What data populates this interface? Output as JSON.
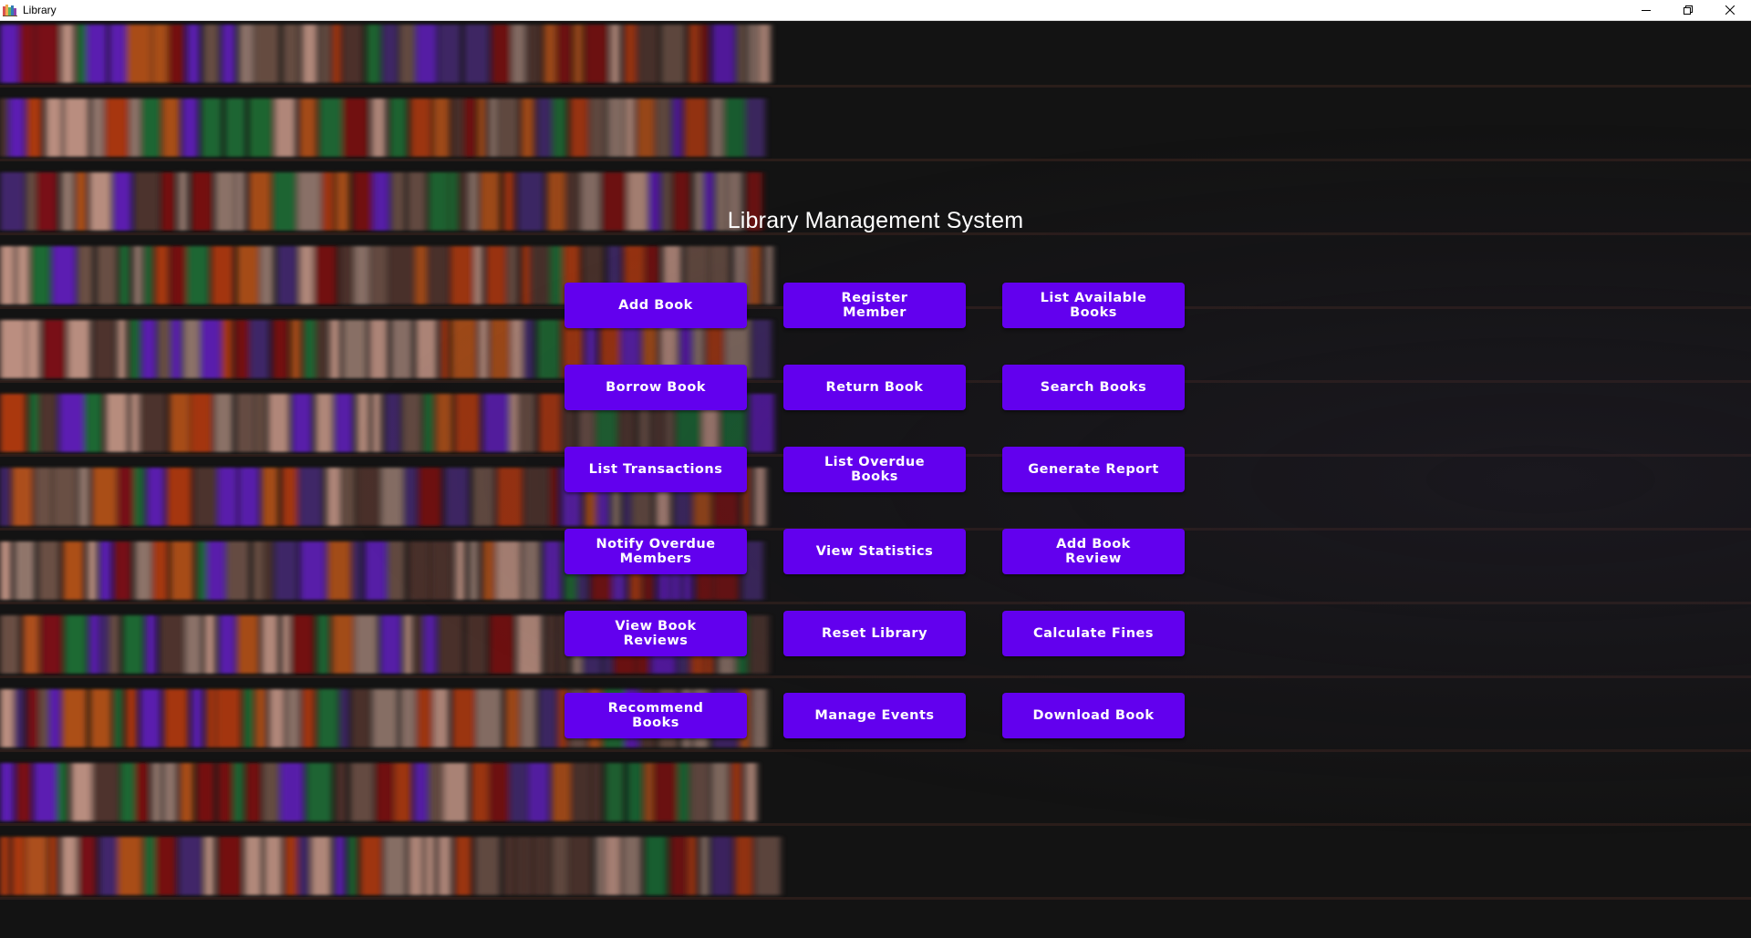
{
  "window": {
    "title": "Library",
    "controls": {
      "minimize": "minimize-icon",
      "maximize": "restore-icon",
      "close": "close-icon"
    }
  },
  "main": {
    "heading": "Library Management System",
    "buttons": [
      {
        "label": "Add Book"
      },
      {
        "label": "Register Member"
      },
      {
        "label": "List Available Books"
      },
      {
        "label": "Borrow Book"
      },
      {
        "label": "Return Book"
      },
      {
        "label": "Search Books"
      },
      {
        "label": "List Transactions"
      },
      {
        "label": "List Overdue Books"
      },
      {
        "label": "Generate Report"
      },
      {
        "label": "Notify Overdue Members"
      },
      {
        "label": "View Statistics"
      },
      {
        "label": "Add Book Review"
      },
      {
        "label": "View Book Reviews"
      },
      {
        "label": "Reset Library"
      },
      {
        "label": "Calculate Fines"
      },
      {
        "label": "Recommend Books"
      },
      {
        "label": "Manage Events"
      },
      {
        "label": "Download Book"
      }
    ]
  },
  "theme": {
    "button_color": "#6200ee",
    "background": "#131313",
    "text_color": "#ffffff"
  },
  "background_image": "blurred-bookshelf"
}
